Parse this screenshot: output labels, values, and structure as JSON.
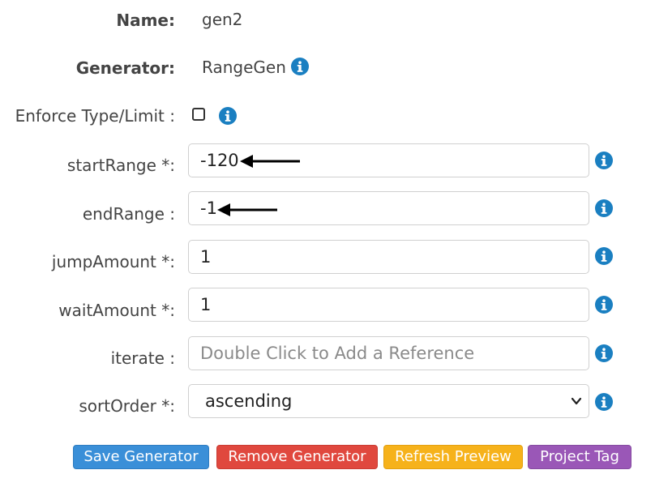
{
  "form": {
    "name_label": "Name:",
    "name_value": "gen2",
    "generator_label": "Generator:",
    "generator_value": "RangeGen",
    "enforce_label": "Enforce Type/Limit :",
    "enforce_checked": false,
    "fields": [
      {
        "label": "startRange *:",
        "value": "-120",
        "placeholder": ""
      },
      {
        "label": "endRange :",
        "value": "-1",
        "placeholder": ""
      },
      {
        "label": "jumpAmount *:",
        "value": "1",
        "placeholder": ""
      },
      {
        "label": "waitAmount *:",
        "value": "1",
        "placeholder": ""
      },
      {
        "label": "iterate :",
        "value": "",
        "placeholder": "Double Click to Add a Reference"
      }
    ],
    "sort_label": "sortOrder *:",
    "sort_value": "ascending"
  },
  "buttons": {
    "save": {
      "label": "Save Generator",
      "color": "#3a8fd8"
    },
    "remove": {
      "label": "Remove Generator",
      "color": "#e0483e"
    },
    "refresh": {
      "label": "Refresh Preview",
      "color": "#f6b21b"
    },
    "tag": {
      "label": "Project Tag",
      "color": "#9a57b7"
    }
  },
  "icons": {
    "info": "info-icon",
    "arrow": "left-arrow-annotation",
    "chevron": "chevron-down-icon"
  },
  "colors": {
    "info_blue": "#1a7fc1"
  }
}
